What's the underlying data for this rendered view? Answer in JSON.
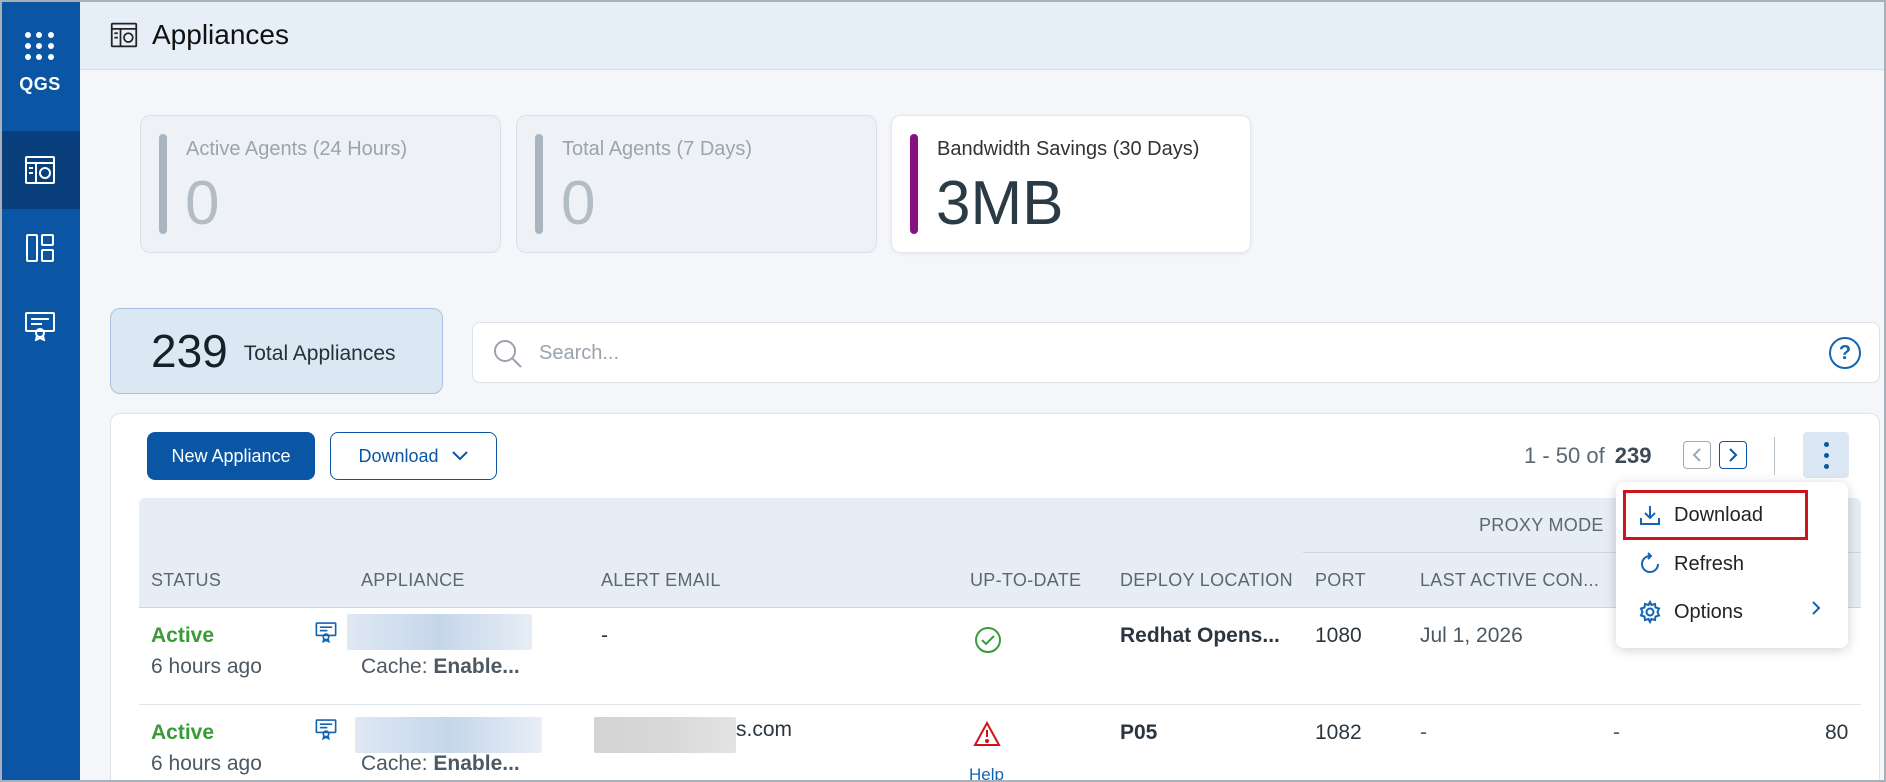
{
  "rail": {
    "brand": "QGS",
    "items": [
      {
        "icon": "appliances-icon",
        "active": true
      },
      {
        "icon": "dashboard-icon",
        "active": false
      },
      {
        "icon": "certificate-icon",
        "active": false
      }
    ]
  },
  "header": {
    "title": "Appliances",
    "icon": "appliances-icon"
  },
  "stats": [
    {
      "label": "Active Agents (24 Hours)",
      "value": "0",
      "active": false
    },
    {
      "label": "Total Agents (7 Days)",
      "value": "0",
      "active": false
    },
    {
      "label": "Bandwidth Savings (30 Days)",
      "value": "3MB",
      "active": true,
      "accent": "#86107f"
    }
  ],
  "total": {
    "count": "239",
    "label": "Total Appliances"
  },
  "search": {
    "placeholder": "Search...",
    "value": ""
  },
  "toolbar": {
    "new_label": "New Appliance",
    "download_label": "Download",
    "pager_range": "1 - 50 of",
    "pager_total": "239"
  },
  "menu": {
    "items": [
      {
        "label": "Download",
        "icon": "download-icon",
        "highlighted": true
      },
      {
        "label": "Refresh",
        "icon": "refresh-icon",
        "highlighted": false
      },
      {
        "label": "Options",
        "icon": "gear-icon",
        "highlighted": false,
        "submenu": true
      }
    ]
  },
  "table": {
    "group_header": "PROXY MODE",
    "columns": [
      "STATUS",
      "APPLIANCE",
      "ALERT EMAIL",
      "UP-TO-DATE",
      "DEPLOY LOCATION",
      "PORT",
      "LAST ACTIVE CON..."
    ],
    "rows": [
      {
        "status": "Active",
        "time": "6 hours ago",
        "cache_label": "Cache:",
        "cache_value": "Enable...",
        "email": "-",
        "uptodate_icon": "check-circle-icon",
        "uptodate_link": "",
        "location": "Redhat Opens...",
        "port": "1080",
        "last_active": "Jul 1, 2026",
        "extra": "",
        "last": ""
      },
      {
        "status": "Active",
        "time": "6 hours ago",
        "cache_label": "Cache:",
        "cache_value": "Enable...",
        "email": "s.com",
        "uptodate_icon": "warning-icon",
        "uptodate_link": "Help",
        "location": "P05",
        "port": "1082",
        "last_active": "-",
        "extra": "-",
        "last": "80"
      }
    ]
  },
  "colors": {
    "primary": "#0b56a4",
    "active": "#3a9a38",
    "highlight": "#d0121b"
  }
}
